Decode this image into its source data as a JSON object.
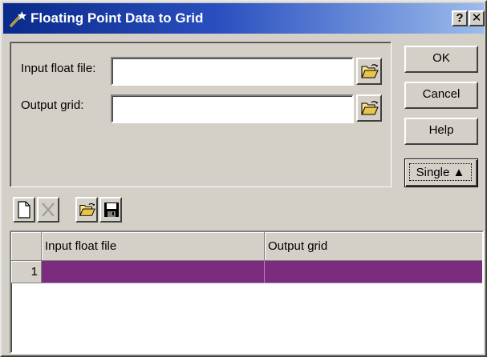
{
  "window": {
    "title": "Floating Point Data to Grid",
    "help_glyph": "?",
    "close_glyph": "✕"
  },
  "form": {
    "input_label": "Input float file:",
    "input_value": "",
    "output_label": "Output grid:",
    "output_value": ""
  },
  "buttons": {
    "ok": "OK",
    "cancel": "Cancel",
    "help": "Help",
    "single": "Single ▲"
  },
  "toolbar": {
    "icons": [
      "new-icon",
      "delete-icon",
      "open-folder-icon",
      "save-icon"
    ]
  },
  "grid": {
    "columns": [
      "Input float file",
      "Output grid"
    ],
    "rows": [
      {
        "num": "1",
        "input": "",
        "output": ""
      }
    ],
    "selected_row_color": "#7b2c7f"
  }
}
